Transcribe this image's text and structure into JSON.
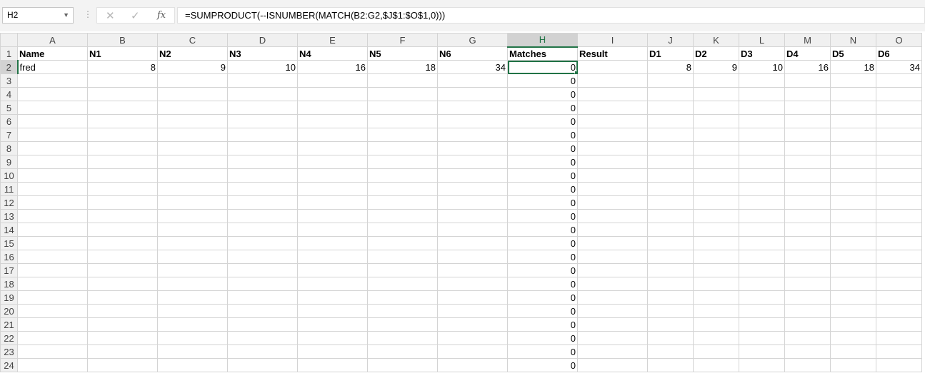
{
  "formula_bar": {
    "name_box": "H2",
    "cancel_icon": "✕",
    "enter_icon": "✓",
    "fx_label": "fx",
    "formula": "=SUMPRODUCT(--ISNUMBER(MATCH(B2:G2,$J$1:$O$1,0)))"
  },
  "sheet": {
    "columns": [
      "A",
      "B",
      "C",
      "D",
      "E",
      "F",
      "G",
      "H",
      "I",
      "J",
      "K",
      "L",
      "M",
      "N",
      "O"
    ],
    "selected_cell": "H2",
    "row1": [
      "Name",
      "N1",
      "N2",
      "N3",
      "N4",
      "N5",
      "N6",
      "Matches",
      "Result",
      "D1",
      "D2",
      "D3",
      "D4",
      "D5",
      "D6"
    ],
    "row2": [
      "fred",
      "8",
      "9",
      "10",
      "16",
      "18",
      "34",
      "0",
      "",
      "8",
      "9",
      "10",
      "16",
      "18",
      "34"
    ],
    "h_values": [
      "0",
      "0",
      "0",
      "0",
      "0",
      "0",
      "0",
      "0",
      "0",
      "0",
      "0",
      "0",
      "0",
      "0",
      "0",
      "0",
      "0",
      "0",
      "0",
      "0",
      "0",
      "0"
    ],
    "row_numbers": [
      "1",
      "2",
      "3",
      "4",
      "5",
      "6",
      "7",
      "8",
      "9",
      "10",
      "11",
      "12",
      "13",
      "14",
      "15",
      "16",
      "17",
      "18",
      "19",
      "20",
      "21",
      "22",
      "23",
      "24"
    ]
  }
}
